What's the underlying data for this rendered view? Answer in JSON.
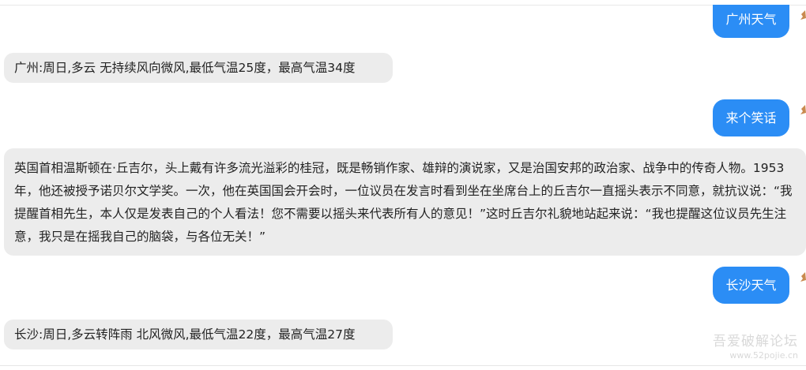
{
  "messages": [
    {
      "role": "user",
      "text": "广州天气"
    },
    {
      "role": "bot",
      "text": "广州:周日,多云 无持续风向微风,最低气温25度，最高气温34度"
    },
    {
      "role": "user",
      "text": "来个笑话"
    },
    {
      "role": "bot",
      "text": "英国首相温斯顿在·丘吉尔，头上戴有许多流光溢彩的桂冠，既是畅销作家、雄辩的演说家，又是治国安邦的政治家、战争中的传奇人物。1953年，他还被授予诺贝尔文学奖。一次，他在英国国会开会时，一位议员在发言时看到坐在坐席台上的丘吉尔一直摇头表示不同意，就抗议说：“我提醒首相先生，本人仅是发表自己的个人看法！您不需要以摇头来代表所有人的意见！”这时丘吉尔礼貌地站起来说：“我也提醒这位议员先生注意，我只是在摇我自己的脑袋，与各位无关！”"
    },
    {
      "role": "user",
      "text": "长沙天气"
    },
    {
      "role": "bot",
      "text": "长沙:周日,多云转阵雨 北风微风,最低气温22度，最高气温27度"
    }
  ],
  "watermark": {
    "main": "吾爱破解论坛",
    "url": "www.52pojie.cn"
  },
  "colors": {
    "user_bubble": "#2b8df5",
    "bot_bubble": "#ececec",
    "text": "#222222"
  }
}
